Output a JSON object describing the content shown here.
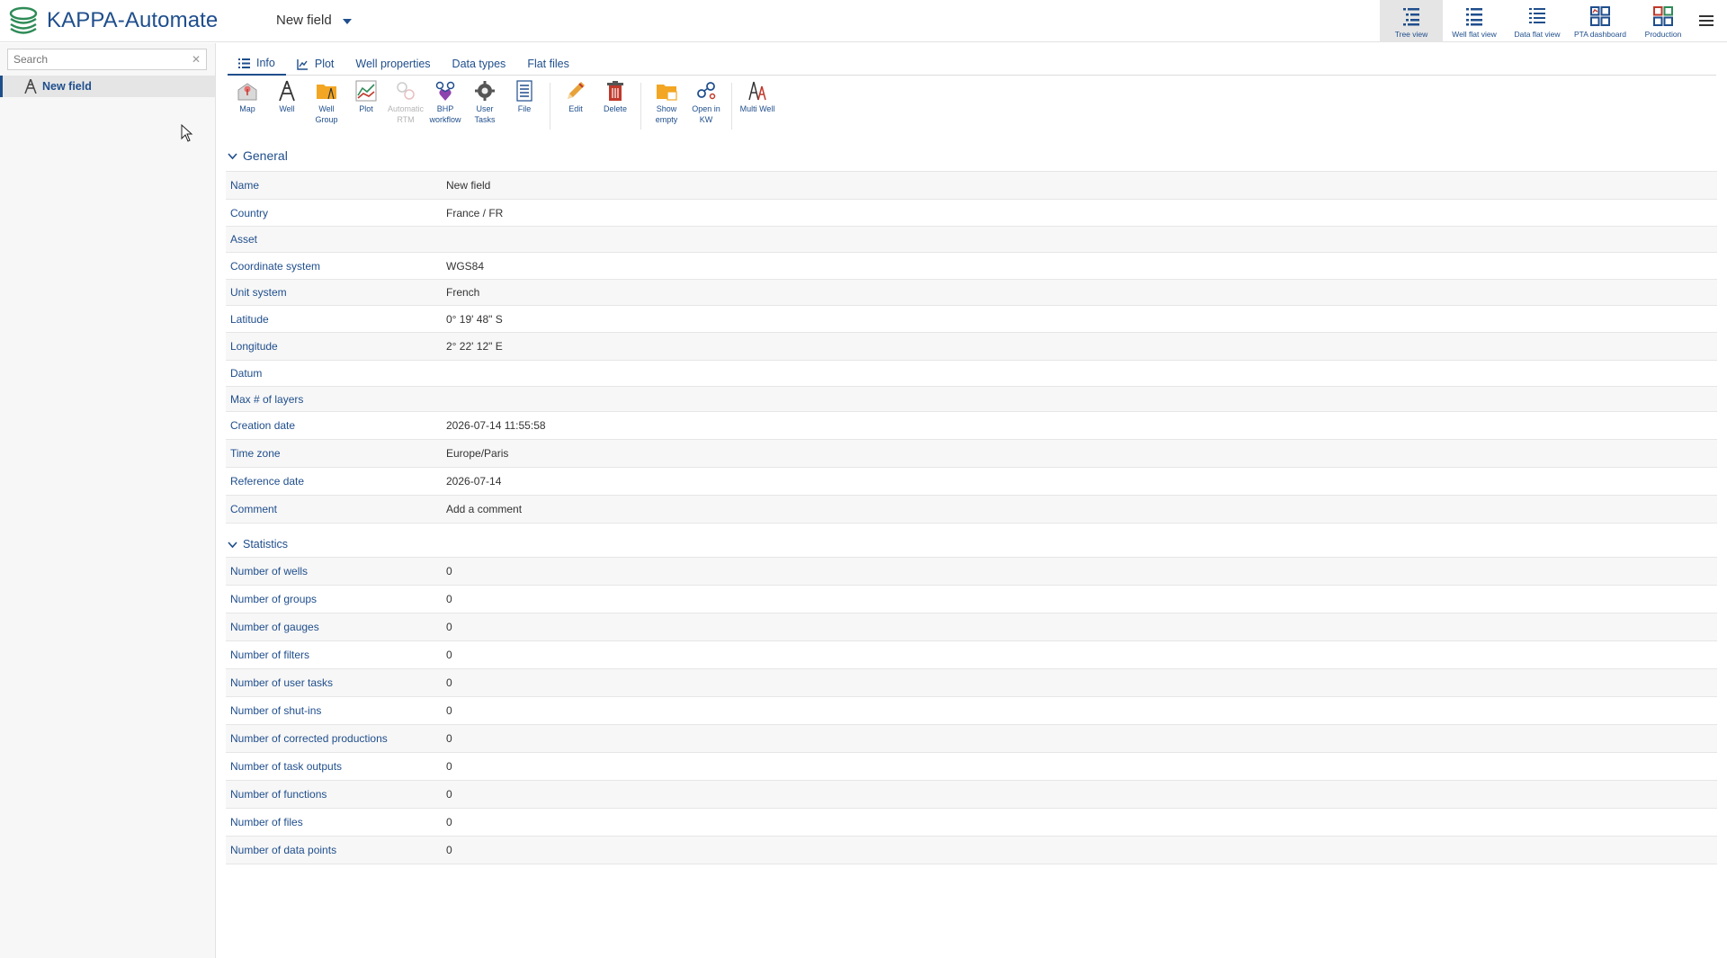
{
  "app": {
    "title": "KAPPA-Automate",
    "field_selector": "New field"
  },
  "views": [
    {
      "label": "Tree view",
      "icon": "tree-view-icon",
      "active": true
    },
    {
      "label": "Well flat view",
      "icon": "well-flat-view-icon",
      "active": false
    },
    {
      "label": "Data flat view",
      "icon": "data-flat-view-icon",
      "active": false
    },
    {
      "label": "PTA dashboard",
      "icon": "pta-dashboard-icon",
      "active": false
    },
    {
      "label": "Production",
      "icon": "production-icon",
      "active": false
    }
  ],
  "sidebar": {
    "search_placeholder": "Search",
    "clear_glyph": "✕",
    "tree": [
      {
        "label": "New field",
        "icon": "field-icon",
        "selected": true
      }
    ]
  },
  "tabs": [
    {
      "label": "Info",
      "icon": "list-icon",
      "active": true
    },
    {
      "label": "Plot",
      "icon": "line-chart-icon",
      "active": false
    },
    {
      "label": "Well properties",
      "active": false
    },
    {
      "label": "Data types",
      "active": false
    },
    {
      "label": "Flat files",
      "active": false
    }
  ],
  "toolbar": [
    {
      "label": "Map",
      "icon": "map-icon"
    },
    {
      "label": "Well",
      "icon": "well-icon"
    },
    {
      "label": "Well Group",
      "icon": "well-group-icon"
    },
    {
      "label": "Plot",
      "icon": "plot-icon"
    },
    {
      "label": "Automatic RTM",
      "icon": "automatic-rtm-icon",
      "disabled": true
    },
    {
      "label": "BHP workflow",
      "icon": "bhp-workflow-icon"
    },
    {
      "label": "User Tasks",
      "icon": "user-tasks-icon"
    },
    {
      "label": "File",
      "icon": "file-icon"
    },
    {
      "label": "Edit",
      "icon": "edit-icon"
    },
    {
      "label": "Delete",
      "icon": "delete-icon"
    },
    {
      "label": "Show empty",
      "icon": "show-empty-icon"
    },
    {
      "label": "Open in KW",
      "icon": "open-in-kw-icon"
    },
    {
      "label": "Multi Well",
      "icon": "multi-well-icon"
    }
  ],
  "general": {
    "title": "General",
    "rows": [
      {
        "key": "Name",
        "value": "New field"
      },
      {
        "key": "Country",
        "value": "France / FR"
      },
      {
        "key": "Asset",
        "value": ""
      },
      {
        "key": "Coordinate system",
        "value": "WGS84"
      },
      {
        "key": "Unit system",
        "value": "French"
      },
      {
        "key": "Latitude",
        "value": "0° 19' 48\" S"
      },
      {
        "key": "Longitude",
        "value": "2° 22' 12\" E"
      },
      {
        "key": "Datum",
        "value": ""
      },
      {
        "key": "Max # of layers",
        "value": ""
      },
      {
        "key": "Creation date",
        "value": "2026-07-14 11:55:58"
      },
      {
        "key": "Time zone",
        "value": "Europe/Paris"
      },
      {
        "key": "Reference date",
        "value": "2026-07-14"
      },
      {
        "key": "Comment",
        "value": "Add a comment"
      }
    ]
  },
  "statistics": {
    "title": "Statistics",
    "rows": [
      {
        "key": "Number of wells",
        "value": "0"
      },
      {
        "key": "Number of groups",
        "value": "0"
      },
      {
        "key": "Number of gauges",
        "value": "0"
      },
      {
        "key": "Number of filters",
        "value": "0"
      },
      {
        "key": "Number of user tasks",
        "value": "0"
      },
      {
        "key": "Number of shut-ins",
        "value": "0"
      },
      {
        "key": "Number of corrected productions",
        "value": "0"
      },
      {
        "key": "Number of task outputs",
        "value": "0"
      },
      {
        "key": "Number of functions",
        "value": "0"
      },
      {
        "key": "Number of files",
        "value": "0"
      },
      {
        "key": "Number of data points",
        "value": "0"
      }
    ]
  },
  "colors": {
    "brand": "#1f4e8c",
    "accent_orange": "#f2a623",
    "delete_red": "#c0392b",
    "edit_orange": "#e8a23a"
  }
}
